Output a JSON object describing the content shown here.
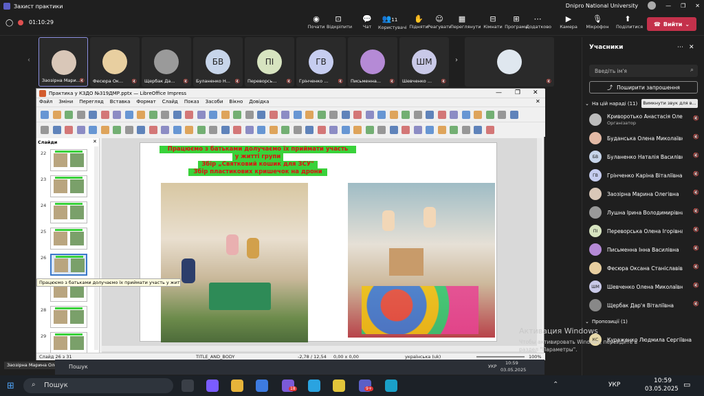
{
  "window": {
    "title": "Захист практики",
    "account": "Dnipro National University"
  },
  "meeting": {
    "timer": "01:10:29",
    "leave_label": "Вийти",
    "toolbar": [
      {
        "label": "Почати",
        "icon": "record-icon"
      },
      {
        "label": "Відкріпити",
        "icon": "unpin-icon"
      },
      {
        "label": "Чат",
        "icon": "chat-icon"
      },
      {
        "label": "Користувачі",
        "icon": "people-icon",
        "count": "11"
      },
      {
        "label": "Підняти",
        "icon": "raise-hand-icon"
      },
      {
        "label": "Реагувати",
        "icon": "react-icon"
      },
      {
        "label": "Переглянути",
        "icon": "view-icon"
      },
      {
        "label": "Кімнати",
        "icon": "rooms-icon"
      },
      {
        "label": "Програми",
        "icon": "apps-icon"
      },
      {
        "label": "Додатково",
        "icon": "more-icon"
      },
      {
        "label": "Камера",
        "icon": "camera-icon"
      },
      {
        "label": "Мікрофон",
        "icon": "mic-icon"
      },
      {
        "label": "Поділитися",
        "icon": "share-icon"
      }
    ]
  },
  "gallery": [
    {
      "name": "Заозірна Мари...",
      "initials": "",
      "color": "#d9c7b8"
    },
    {
      "name": "Фесюра Ок...",
      "initials": "",
      "color": "#e8cfa0"
    },
    {
      "name": "Щербак Да...",
      "initials": "",
      "color": "#9a9a9a"
    },
    {
      "name": "Буланенко Н...",
      "initials": "БВ",
      "color": "#c7d5ea"
    },
    {
      "name": "Переворсь...",
      "initials": "ПІ",
      "color": "#d7e4c0"
    },
    {
      "name": "Грінченко ...",
      "initials": "ГВ",
      "color": "#c6cdf0"
    },
    {
      "name": "Письменна...",
      "initials": "",
      "color": "#b58ad6"
    },
    {
      "name": "Шевченко ...",
      "initials": "ШМ",
      "color": "#c9c9e8"
    },
    {
      "name": "",
      "initials": "",
      "color": "#dfe7ef"
    }
  ],
  "participants": {
    "title": "Учасники",
    "search_placeholder": "Введіть ім'я",
    "invite_label": "Поширити запрошення",
    "in_meeting_label": "На цій нараді (11)",
    "mute_all_label": "Вимкнути звук для в...",
    "list": [
      {
        "name": "Криворотько Анастасія Олекс...",
        "sub": "Організатор",
        "initials": "",
        "color": "#bbb"
      },
      {
        "name": "Буданська Олена Миколаївна",
        "sub": "",
        "initials": "",
        "color": "#e2b9a5"
      },
      {
        "name": "Буланенко Наталія Василівна",
        "sub": "",
        "initials": "БВ",
        "color": "#c7d5ea"
      },
      {
        "name": "Грінченко Каріна Віталіївна",
        "sub": "",
        "initials": "ГВ",
        "color": "#c6cdf0"
      },
      {
        "name": "Заозірна Марина Олегівна",
        "sub": "",
        "initials": "",
        "color": "#d9c7b8"
      },
      {
        "name": "Лушна Ірина Володимирівна",
        "sub": "",
        "initials": "",
        "color": "#999"
      },
      {
        "name": "Переворська Олена Ігорівна",
        "sub": "",
        "initials": "ПІ",
        "color": "#d7e4c0"
      },
      {
        "name": "Письменна Інна Василівна",
        "sub": "",
        "initials": "",
        "color": "#b58ad6"
      },
      {
        "name": "Фесюра Оксана Станіславівна",
        "sub": "",
        "initials": "",
        "color": "#e8cfa0"
      },
      {
        "name": "Шевченко Олена Миколаївна",
        "sub": "",
        "initials": "ШМ",
        "color": "#c9c9e8"
      },
      {
        "name": "Щербак Дар'я Віталіївна",
        "sub": "",
        "initials": "",
        "color": "#888"
      }
    ],
    "proposals_label": "Пропозиції (1)",
    "proposal": {
      "name": "Кураженко Людмила Сергіївна",
      "initials": "КС"
    }
  },
  "impress": {
    "title": "Практика у КЗДО №319ДМР.pptx — LibreOffice Impress",
    "menu": [
      "Файл",
      "Зміни",
      "Перегляд",
      "Вставка",
      "Формат",
      "Слайд",
      "Показ",
      "Засоби",
      "Вікно",
      "Довідка"
    ],
    "slides_label": "Слайди",
    "thumbs": [
      "22",
      "23",
      "24",
      "25",
      "26",
      "27",
      "28",
      "29"
    ],
    "tooltip": "Працюємо з батьками долучаємо їх приймати участь у житті групи",
    "slide_text": [
      "Працюємо з батьками долучаємо їх приймати участь",
      "у житті групи",
      "Збір „Святковий кошик для ЗСУ\"",
      "Збір пластикових кришечок на дрони"
    ],
    "status": {
      "slide": "Слайд 26 з 31",
      "layout": "TITLE_AND_BODY",
      "pos": "-2,78 / 12,54",
      "size": "0,00 x 0,00",
      "lang": "українська (uk)",
      "zoom": "100%"
    }
  },
  "watermark": {
    "line1": "Активация Windows",
    "line2": "Чтобы активировать Windows, перейдите в",
    "line3": "раздел \"Параметры\"."
  },
  "overlay": {
    "presenter": "Заозірна Марина Олегівна",
    "search_small": "Пошук",
    "lang_small": "УКР",
    "time_small": "10:59",
    "date_small": "03.05.2025"
  },
  "taskbar": {
    "search": "Пошук",
    "lang": "УКР",
    "time": "10:59",
    "date": "03.05.2025",
    "badge1": "18",
    "badge2": "9+"
  }
}
